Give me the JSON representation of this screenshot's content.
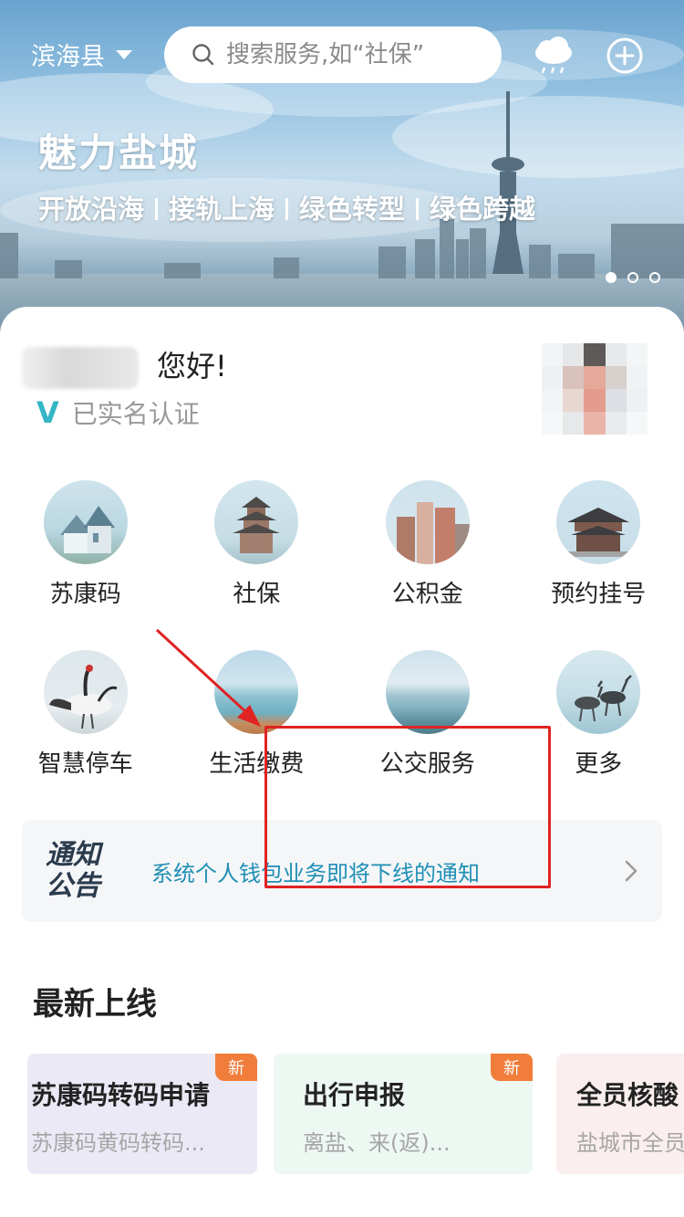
{
  "header": {
    "city": "滨海县",
    "search_placeholder": "搜索服务,如“社保”",
    "weather_icon": "rain-cloud-icon",
    "add_icon": "plus-circle-icon"
  },
  "banner": {
    "title": "魅力盐城",
    "slogans": [
      "开放沿海",
      "接轨上海",
      "绿色转型",
      "绿色跨越"
    ],
    "slides_total": 3,
    "active_slide": 1
  },
  "user": {
    "greeting": "您好!",
    "verified_mark": "V",
    "verified_text": "已实名认证"
  },
  "services": [
    {
      "label": "苏康码",
      "icon": "house-photo-icon"
    },
    {
      "label": "社保",
      "icon": "pagoda-photo-icon"
    },
    {
      "label": "公积金",
      "icon": "buildings-photo-icon"
    },
    {
      "label": "预约挂号",
      "icon": "temple-photo-icon"
    },
    {
      "label": "智慧停车",
      "icon": "crane-bird-photo-icon"
    },
    {
      "label": "生活缴费",
      "icon": "seaside-photo-icon"
    },
    {
      "label": "公交服务",
      "icon": "coast-photo-icon"
    },
    {
      "label": "更多",
      "icon": "deer-photo-icon"
    }
  ],
  "notice": {
    "logo_line1": "通知",
    "logo_line2": "公告",
    "text": "系统个人钱包业务即将下线的通知"
  },
  "latest": {
    "title": "最新上线",
    "cards": [
      {
        "title": "苏康码转码申请",
        "desc": "苏康码黄码转码...",
        "badge": "新",
        "bg": "#ece9f7"
      },
      {
        "title": "出行申报",
        "desc": "离盐、来(返)...",
        "badge": "新",
        "bg": "#eef8f3"
      },
      {
        "title": "全员核酸",
        "desc": "盐城市全员",
        "bg": "#fbeeee"
      }
    ]
  },
  "colors": {
    "accent_blue": "#1f8fb5",
    "verified_teal": "#35b6c7",
    "badge_orange": "#f07d3a",
    "annotation_red": "#e02323"
  }
}
